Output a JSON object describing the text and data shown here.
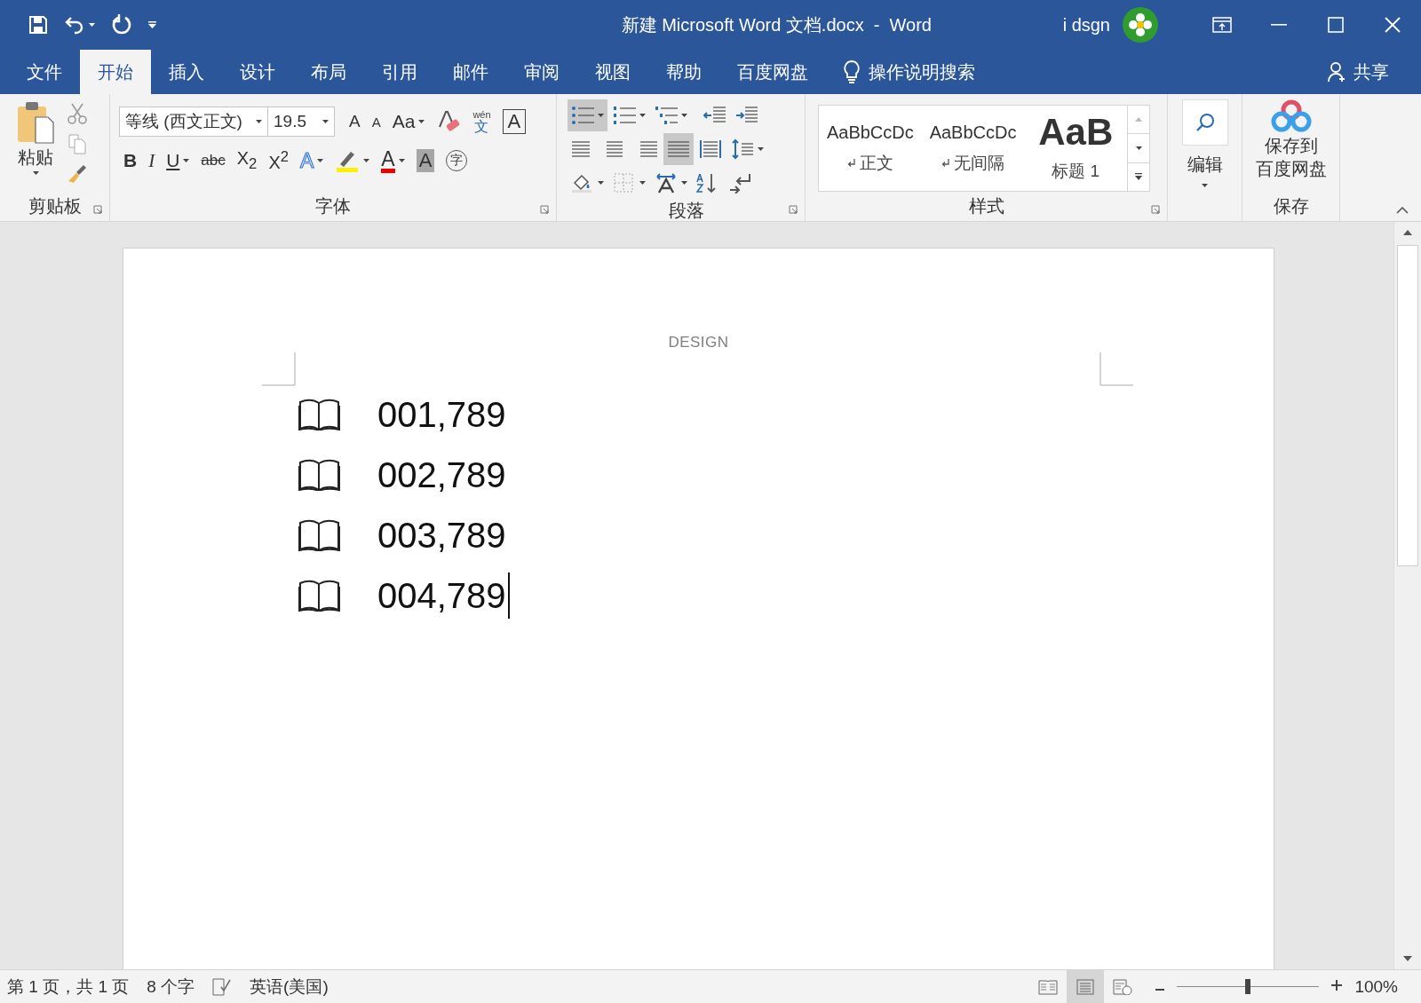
{
  "window": {
    "title": "新建 Microsoft Word 文档.docx  -  Word",
    "user": "i dsgn"
  },
  "tabs": [
    {
      "label": "文件",
      "selected": false
    },
    {
      "label": "开始",
      "selected": true
    },
    {
      "label": "插入",
      "selected": false
    },
    {
      "label": "设计",
      "selected": false
    },
    {
      "label": "布局",
      "selected": false
    },
    {
      "label": "引用",
      "selected": false
    },
    {
      "label": "邮件",
      "selected": false
    },
    {
      "label": "审阅",
      "selected": false
    },
    {
      "label": "视图",
      "selected": false
    },
    {
      "label": "帮助",
      "selected": false
    },
    {
      "label": "百度网盘",
      "selected": false
    }
  ],
  "tell_me": "操作说明搜索",
  "share": "共享",
  "ribbon": {
    "clipboard": {
      "paste": "粘贴",
      "label": "剪贴板"
    },
    "font": {
      "name": "等线 (西文正文)",
      "size": "19.5",
      "label": "字体",
      "row1": [
        {
          "kind": "grow",
          "text": "A"
        },
        {
          "kind": "shrink",
          "text": "A"
        },
        {
          "kind": "case",
          "text": "Aa"
        },
        {
          "kind": "clear"
        },
        {
          "kind": "phonetic",
          "ruby": "wén",
          "text": "文"
        },
        {
          "kind": "border",
          "text": "A"
        }
      ],
      "row2": [
        {
          "kind": "bold",
          "text": "B"
        },
        {
          "kind": "italic",
          "text": "I"
        },
        {
          "kind": "underline",
          "text": "U"
        },
        {
          "kind": "strike",
          "text": "abc"
        },
        {
          "kind": "script",
          "text": "X$_{2}$"
        },
        {
          "kind": "script",
          "text": "X$^{2}$"
        },
        {
          "kind": "effect",
          "text": "A"
        },
        {
          "kind": "highlight"
        },
        {
          "kind": "color",
          "text": "A"
        },
        {
          "kind": "shading",
          "text": "A"
        },
        {
          "kind": "enclose",
          "text": "字"
        }
      ]
    },
    "paragraph": {
      "label": "段落"
    },
    "styles": {
      "label": "样式",
      "items": [
        {
          "sample": "AaBbCcDc",
          "name": "正文",
          "kind": "body"
        },
        {
          "sample": "AaBbCcDc",
          "name": "无间隔",
          "kind": "body"
        },
        {
          "sample": "AaB",
          "name": "标题 1",
          "kind": "heading"
        }
      ]
    },
    "editing": {
      "label": "编辑"
    },
    "save": {
      "lines": [
        "保存到",
        "百度网盘"
      ],
      "label": "保存"
    }
  },
  "document": {
    "header": "DESIGN",
    "lines": [
      {
        "text": "001,789",
        "cursor": false
      },
      {
        "text": "002,789",
        "cursor": false
      },
      {
        "text": "003,789",
        "cursor": false
      },
      {
        "text": "004,789",
        "cursor": true
      }
    ]
  },
  "status_bar": {
    "page": "第 1 页，共 1 页",
    "words": "8 个字",
    "language": "英语(美国)",
    "views": [
      {
        "kind": "read",
        "selected": false
      },
      {
        "kind": "print",
        "selected": true
      },
      {
        "kind": "web",
        "selected": false
      }
    ],
    "zoom": {
      "level": 0.5,
      "reading": "100%"
    }
  }
}
